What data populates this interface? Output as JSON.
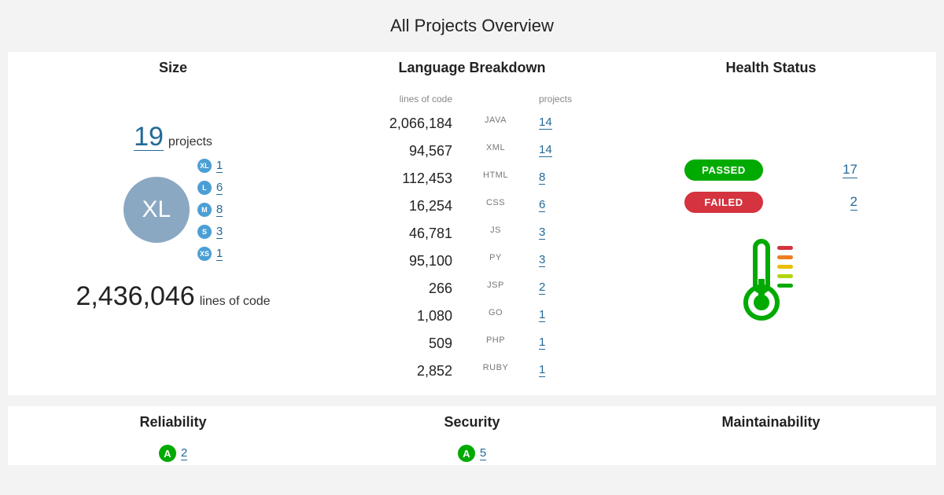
{
  "title": "All Projects Overview",
  "size": {
    "heading": "Size",
    "projects_count": "19",
    "projects_label": "projects",
    "bubble_label": "XL",
    "buckets": [
      {
        "label": "XL",
        "count": "1"
      },
      {
        "label": "L",
        "count": "6"
      },
      {
        "label": "M",
        "count": "8"
      },
      {
        "label": "S",
        "count": "3"
      },
      {
        "label": "XS",
        "count": "1"
      }
    ],
    "loc": "2,436,046",
    "loc_label": "lines of code"
  },
  "languages": {
    "heading": "Language Breakdown",
    "loc_header": "lines of code",
    "proj_header": "projects",
    "rows": [
      {
        "loc": "2,066,184",
        "name": "JAVA",
        "projects": "14"
      },
      {
        "loc": "94,567",
        "name": "XML",
        "projects": "14"
      },
      {
        "loc": "112,453",
        "name": "HTML",
        "projects": "8"
      },
      {
        "loc": "16,254",
        "name": "CSS",
        "projects": "6"
      },
      {
        "loc": "46,781",
        "name": "JS",
        "projects": "3"
      },
      {
        "loc": "95,100",
        "name": "PY",
        "projects": "3"
      },
      {
        "loc": "266",
        "name": "JSP",
        "projects": "2"
      },
      {
        "loc": "1,080",
        "name": "GO",
        "projects": "1"
      },
      {
        "loc": "509",
        "name": "PHP",
        "projects": "1"
      },
      {
        "loc": "2,852",
        "name": "RUBY",
        "projects": "1"
      }
    ]
  },
  "health": {
    "heading": "Health Status",
    "passed_label": "PASSED",
    "passed_count": "17",
    "failed_label": "FAILED",
    "failed_count": "2"
  },
  "reliability": {
    "heading": "Reliability",
    "rating": "A",
    "count": "2"
  },
  "security": {
    "heading": "Security",
    "rating": "A",
    "count": "5"
  },
  "maintainability": {
    "heading": "Maintainability"
  }
}
